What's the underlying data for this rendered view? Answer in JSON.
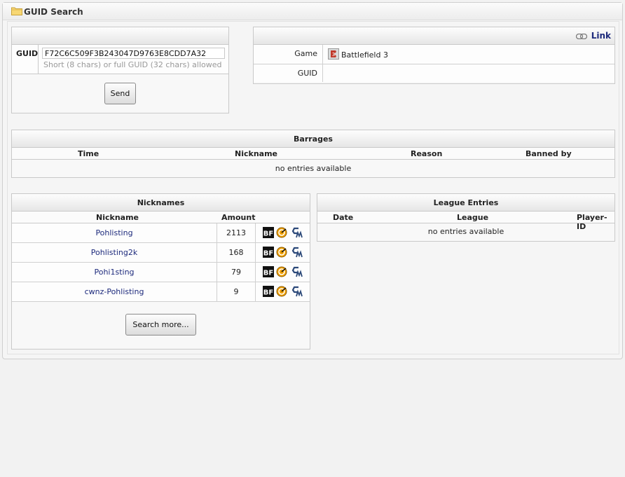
{
  "window": {
    "title": "GUID Search"
  },
  "search": {
    "guid_label": "GUID",
    "guid_value": "F72C6C509F3B243047D9763E8CDD7A32",
    "hint": "Short (8 chars) or full GUID (32 chars) allowed",
    "send_label": "Send"
  },
  "info": {
    "link_label": "Link",
    "game_label": "Game",
    "game_value": "Battlefield 3",
    "guid_label": "GUID",
    "guid_value": ""
  },
  "barrages": {
    "title": "Barrages",
    "columns": [
      "Time",
      "Nickname",
      "Reason",
      "Banned by"
    ],
    "empty": "no entries available"
  },
  "nicknames": {
    "title": "Nicknames",
    "columns": [
      "Nickname",
      "Amount"
    ],
    "rows": [
      {
        "nickname": "Pohlisting",
        "amount": "2113"
      },
      {
        "nickname": "Pohlisting2k",
        "amount": "168"
      },
      {
        "nickname": "Pohi1sting",
        "amount": "79"
      },
      {
        "nickname": "cwnz-Pohlisting",
        "amount": "9"
      }
    ],
    "search_more_label": "Search more..."
  },
  "league": {
    "title": "League Entries",
    "columns": [
      "Date",
      "League",
      "Player-ID"
    ],
    "empty": "no entries available"
  },
  "colors": {
    "link": "#1d2a7c",
    "border": "#c9c9c9",
    "background": "#f2f2f2",
    "icon_orange": "#f0a000"
  },
  "icons": [
    "folder-icon",
    "link-icon",
    "battlefield3-icon",
    "bf-icon",
    "gamersignal-icon",
    "gametracker-icon"
  ]
}
